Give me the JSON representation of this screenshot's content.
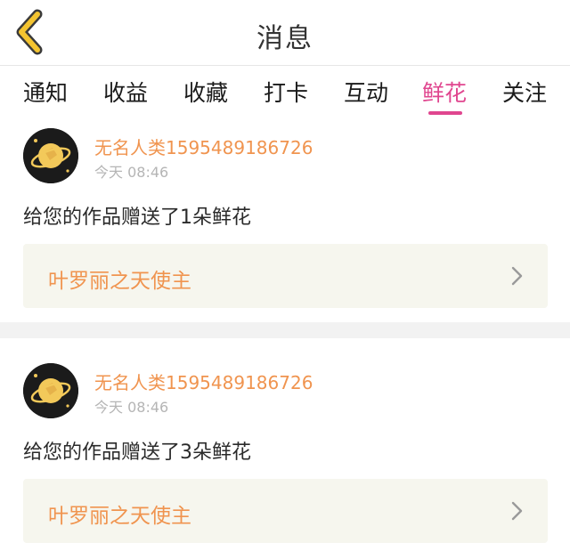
{
  "header": {
    "title": "消息"
  },
  "tabs": [
    {
      "label": "通知"
    },
    {
      "label": "收益"
    },
    {
      "label": "收藏"
    },
    {
      "label": "打卡"
    },
    {
      "label": "互动"
    },
    {
      "label": "鲜花",
      "active": true
    },
    {
      "label": "关注"
    }
  ],
  "messages": [
    {
      "username": "无名人类1595489186726",
      "time": "今天 08:46",
      "text": "给您的作品赠送了1朵鲜花",
      "work_title": "叶罗丽之天使主"
    },
    {
      "username": "无名人类1595489186726",
      "time": "今天 08:46",
      "text": "给您的作品赠送了3朵鲜花",
      "work_title": "叶罗丽之天使主"
    }
  ],
  "colors": {
    "accent": "#e0468f",
    "username": "#f0944f",
    "back_icon": "#f4c430",
    "work_bg": "#f6f6ee"
  },
  "icons": {
    "back": "chevron-left-icon",
    "work_arrow": "chevron-right-icon",
    "avatar": "planet-avatar"
  }
}
